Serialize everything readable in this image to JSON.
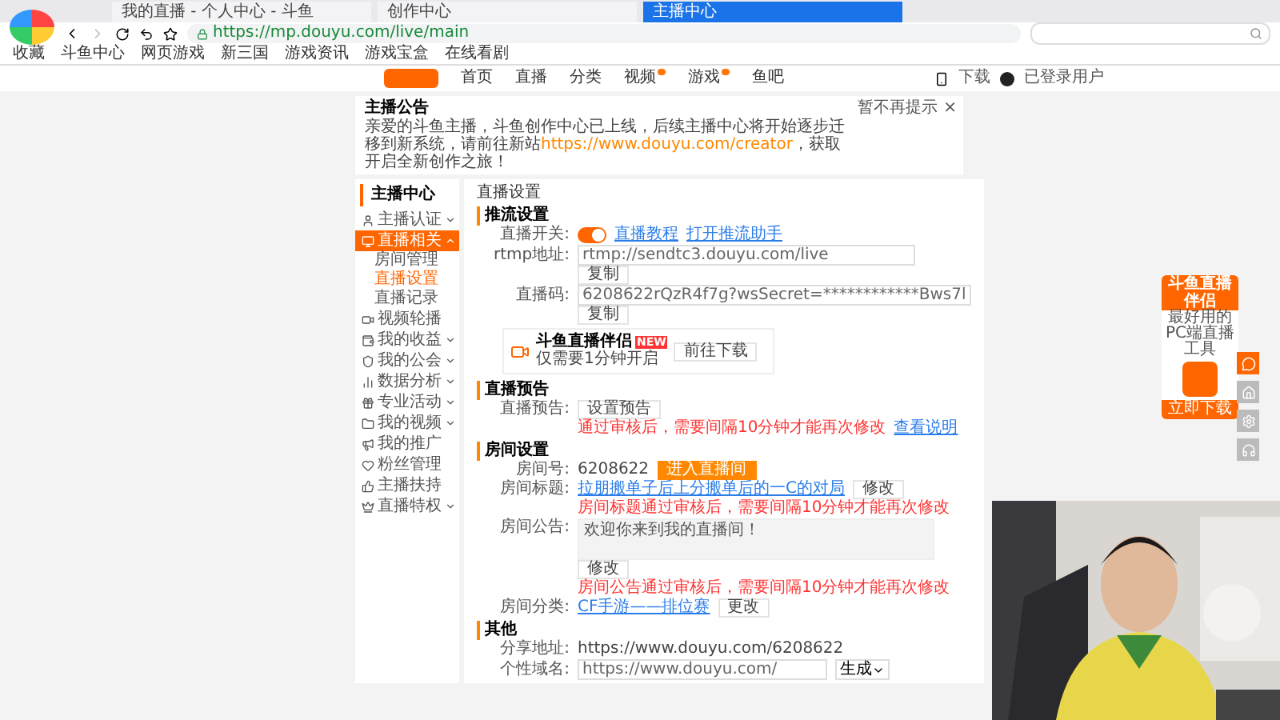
{
  "browser": {
    "tabs": [
      {
        "title": "我的直播 - 个人中心 - 斗鱼",
        "selected": false
      },
      {
        "title": "创作中心",
        "selected": false
      },
      {
        "title": "主播中心",
        "selected": true
      }
    ],
    "url": "https://mp.douyu.com/live/main",
    "bookmarks": [
      "收藏",
      "斗鱼中心",
      "网页游戏",
      "新三国",
      "游戏资讯",
      "游戏宝盒",
      "在线看剧"
    ]
  },
  "site_nav": {
    "items": [
      {
        "label": "首页",
        "badge": false
      },
      {
        "label": "直播",
        "badge": false
      },
      {
        "label": "分类",
        "badge": false
      },
      {
        "label": "视频",
        "badge": true
      },
      {
        "label": "游戏",
        "badge": true
      },
      {
        "label": "鱼吧",
        "badge": false
      }
    ],
    "download": "下载",
    "user": "已登录用户"
  },
  "notice": {
    "title": "主播公告",
    "text": "亲爱的斗鱼主播，斗鱼创作中心已上线，后续主播中心将开始逐步迁移到新系统，请前往新站",
    "link": "https://www.douyu.com/creator",
    "tail": "，获取开启全新创作之旅！",
    "dismiss": "暂不再提示",
    "close": "×"
  },
  "sidebar": {
    "title": "主播中心",
    "items": [
      {
        "label": "主播认证",
        "kind": "group",
        "expanded": false,
        "selected": false
      },
      {
        "label": "直播相关",
        "kind": "group",
        "expanded": true,
        "selected": true,
        "children": [
          {
            "label": "房间管理",
            "selected": false
          },
          {
            "label": "直播设置",
            "selected": true
          },
          {
            "label": "直播记录",
            "selected": false
          }
        ]
      },
      {
        "label": "视频轮播",
        "kind": "link",
        "selected": false
      },
      {
        "label": "我的收益",
        "kind": "group",
        "expanded": false,
        "selected": false
      },
      {
        "label": "我的公会",
        "kind": "group",
        "expanded": false,
        "selected": false
      },
      {
        "label": "数据分析",
        "kind": "group",
        "expanded": false,
        "selected": false
      },
      {
        "label": "专业活动",
        "kind": "group",
        "expanded": false,
        "selected": false
      },
      {
        "label": "我的视频",
        "kind": "group",
        "expanded": false,
        "selected": false
      },
      {
        "label": "我的推广",
        "kind": "link",
        "selected": false
      },
      {
        "label": "粉丝管理",
        "kind": "link",
        "selected": false
      },
      {
        "label": "主播扶持",
        "kind": "link",
        "selected": false
      },
      {
        "label": "直播特权",
        "kind": "group",
        "expanded": false,
        "selected": false
      }
    ]
  },
  "page_title": "直播设置",
  "sections": [
    {
      "title": "推流设置",
      "rows": [
        {
          "kind": "toggle",
          "label": "直播开关:",
          "on": true,
          "links": [
            "直播教程",
            "打开推流助手"
          ]
        },
        {
          "kind": "field",
          "label": "rtmp地址:",
          "value": "rtmp://sendtc3.douyu.com/live"
        },
        {
          "kind": "button",
          "button": "复制"
        },
        {
          "kind": "field",
          "label": "直播码:",
          "value": "6208622rQzR4f7g?wsSecret=************Bws7l"
        },
        {
          "kind": "button",
          "button": "复制"
        },
        {
          "kind": "card",
          "title": "斗鱼直播伴侣",
          "badge": "NEW",
          "subtitle": "仅需要1分钟开启",
          "button": "前往下载"
        }
      ]
    },
    {
      "title": "直播预告",
      "rows": [
        {
          "kind": "plain",
          "label": "直播预告:",
          "button": "设置预告"
        },
        {
          "kind": "note",
          "text": "通过审核后，需要间隔10分钟才能再次修改",
          "link": "查看说明"
        }
      ]
    },
    {
      "title": "房间设置",
      "rows": [
        {
          "kind": "plain",
          "label": "房间号:",
          "value": "6208622",
          "button": "进入直播间",
          "primary": true
        },
        {
          "kind": "linkrow",
          "label": "房间标题:",
          "link": "拉朋搬单子后上分搬单后的一C的对局",
          "button": "修改"
        },
        {
          "kind": "note",
          "text": "房间标题通过审核后，需要间隔10分钟才能再次修改"
        },
        {
          "kind": "textarea",
          "label": "房间公告:",
          "value": "欢迎你来到我的直播间！"
        },
        {
          "kind": "button",
          "button": "修改"
        },
        {
          "kind": "note",
          "text": "房间公告通过审核后，需要间隔10分钟才能再次修改"
        },
        {
          "kind": "linkrow",
          "label": "房间分类:",
          "link": "CF手游——排位赛",
          "button": "更改"
        }
      ]
    },
    {
      "title": "其他",
      "rows": [
        {
          "kind": "plain",
          "label": "分享地址:",
          "value": "https://www.douyu.com/6208622"
        },
        {
          "kind": "select",
          "label": "个性域名:",
          "value": "https://www.douyu.com/",
          "select": "生成"
        }
      ]
    }
  ],
  "promo": {
    "title": "斗鱼直播伴侣",
    "subtitle": "最好用的PC端直播工具",
    "button": "立即下载"
  }
}
